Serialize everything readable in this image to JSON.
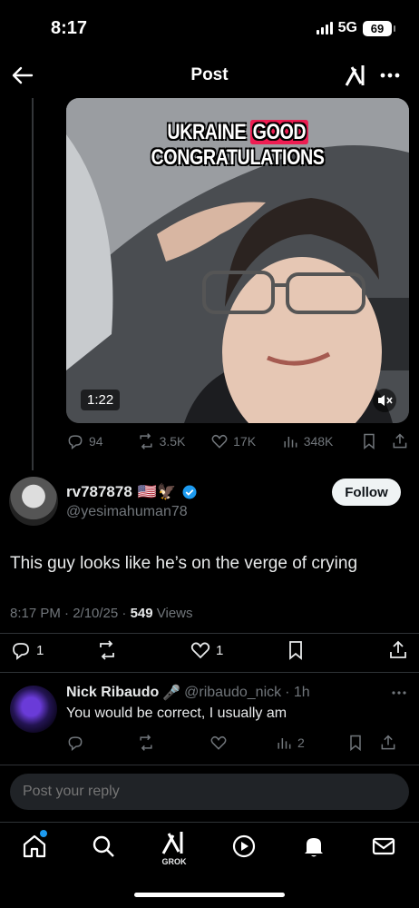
{
  "status_bar": {
    "time": "8:17",
    "network": "5G",
    "battery": "69"
  },
  "header": {
    "title": "Post"
  },
  "video": {
    "caption_pre": "UKRAINE ",
    "caption_highlight": "GOOD",
    "caption_post": " CONGRATULATIONS",
    "duration": "1:22"
  },
  "post_actions": {
    "replies": "94",
    "reposts": "3.5K",
    "likes": "17K",
    "views": "348K"
  },
  "reply_post": {
    "display_name": "rv787878",
    "name_emoji": "🇺🇸🦅",
    "handle": "@yesimahuman78",
    "follow_label": "Follow",
    "text": "This guy looks like he’s on the verge of crying",
    "time": "8:17 PM · 2/10/25 · ",
    "views_count": "549",
    "views_label": " Views",
    "replies": "1",
    "likes": "1"
  },
  "nested_reply": {
    "display_name": "Nick Ribaudo",
    "name_emoji": "🎤",
    "handle": "@ribaudo_nick",
    "age": "· 1h",
    "text": "You would be correct, I usually am",
    "views": "2"
  },
  "composer": {
    "placeholder": "Post your reply"
  },
  "tabbar": {
    "grok_label": "GROK"
  },
  "colors": {
    "accent": "#1d9bf0",
    "muted": "#71767b",
    "text": "#e7e9ea",
    "tiktok_pink": "#ee1d52"
  },
  "icons": [
    "back-arrow-icon",
    "grok-icon",
    "more-icon",
    "reply-icon",
    "repost-icon",
    "like-icon",
    "views-icon",
    "bookmark-icon",
    "share-icon",
    "verified-icon",
    "mute-icon",
    "home-icon",
    "search-icon",
    "play-icon",
    "bell-icon",
    "mail-icon"
  ]
}
